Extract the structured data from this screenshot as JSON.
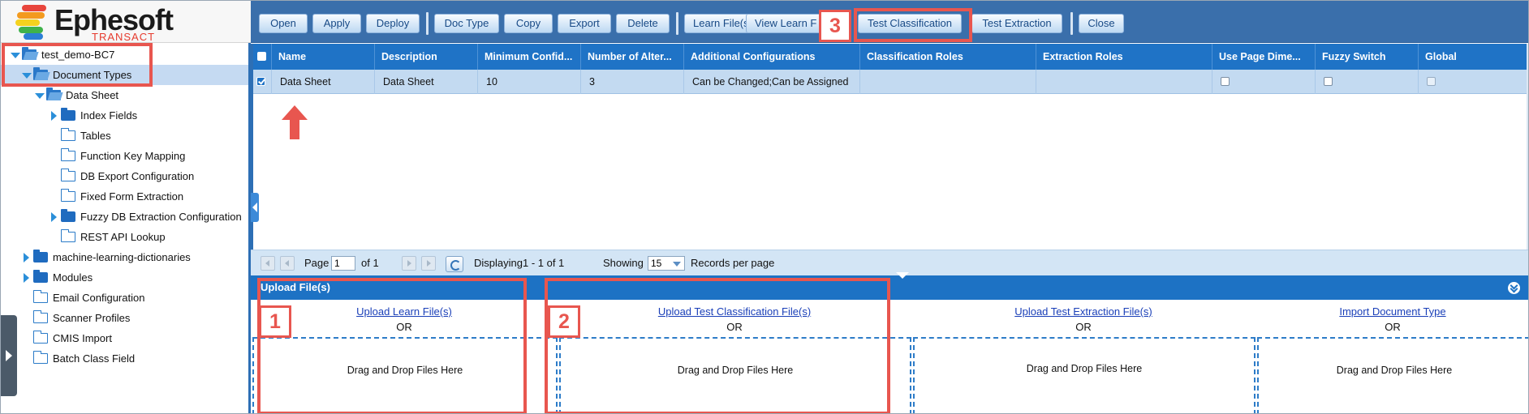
{
  "logo": {
    "brand": "Ephesoft",
    "edition": "TRANSACT"
  },
  "tree": [
    {
      "label": "test_demo-BC7",
      "level": 0,
      "twisty": "down",
      "folder": "open",
      "selected": false
    },
    {
      "label": "Document Types",
      "level": 1,
      "twisty": "down",
      "folder": "open",
      "selected": true
    },
    {
      "label": "Data Sheet",
      "level": 2,
      "twisty": "down",
      "folder": "open",
      "selected": false
    },
    {
      "label": "Index Fields",
      "level": 3,
      "twisty": "right",
      "folder": "filled",
      "selected": false
    },
    {
      "label": "Tables",
      "level": 3,
      "twisty": "none",
      "folder": "outline",
      "selected": false
    },
    {
      "label": "Function Key Mapping",
      "level": 3,
      "twisty": "none",
      "folder": "outline",
      "selected": false
    },
    {
      "label": "DB Export Configuration",
      "level": 3,
      "twisty": "none",
      "folder": "outline",
      "selected": false
    },
    {
      "label": "Fixed Form Extraction",
      "level": 3,
      "twisty": "none",
      "folder": "outline",
      "selected": false
    },
    {
      "label": "Fuzzy DB Extraction Configuration",
      "level": 3,
      "twisty": "right",
      "folder": "filled",
      "selected": false
    },
    {
      "label": "REST API Lookup",
      "level": 3,
      "twisty": "none",
      "folder": "outline",
      "selected": false
    },
    {
      "label": "machine-learning-dictionaries",
      "level": 1,
      "twisty": "right",
      "folder": "filled",
      "selected": false
    },
    {
      "label": "Modules",
      "level": 1,
      "twisty": "right",
      "folder": "filled",
      "selected": false
    },
    {
      "label": "Email Configuration",
      "level": 1,
      "twisty": "none",
      "folder": "outline",
      "selected": false
    },
    {
      "label": "Scanner Profiles",
      "level": 1,
      "twisty": "none",
      "folder": "outline",
      "selected": false
    },
    {
      "label": "CMIS Import",
      "level": 1,
      "twisty": "none",
      "folder": "outline",
      "selected": false
    },
    {
      "label": "Batch Class Field",
      "level": 1,
      "twisty": "none",
      "folder": "outline",
      "selected": false
    }
  ],
  "toolbar": {
    "buttons": [
      "Open",
      "Apply",
      "Deploy",
      "Doc Type",
      "Copy",
      "Export",
      "Delete",
      "Learn File(s)",
      "View Learn F",
      "Test Classification",
      "Test Extraction",
      "Close"
    ]
  },
  "grid": {
    "columns": [
      "Name",
      "Description",
      "Minimum Confid...",
      "Number of Alter...",
      "Additional Configurations",
      "Classification Roles",
      "Extraction Roles",
      "Use Page Dime...",
      "Fuzzy Switch",
      "Global"
    ],
    "rows": [
      {
        "checked": true,
        "cells": [
          "Data Sheet",
          "Data Sheet",
          "10",
          "3",
          "Can be Changed;Can be Assigned",
          "",
          "",
          "",
          "",
          ""
        ]
      }
    ]
  },
  "pager": {
    "page_label": "Page",
    "page_value": "1",
    "of_label": "of 1",
    "displaying": "Displaying1 - 1 of 1",
    "showing_label": "Showing",
    "page_size": "15",
    "records_label": "Records per page"
  },
  "upload": {
    "title": "Upload File(s)",
    "or_text": "OR",
    "drop_text": "Drag and Drop Files Here",
    "links": [
      "Upload Learn File(s)",
      "Upload Test Classification File(s)",
      "Upload Test Extraction File(s)",
      "Import Document Type"
    ]
  },
  "annotations": {
    "badges": [
      "1",
      "2",
      "3"
    ],
    "color": "#e8564f"
  },
  "colors": {
    "header_blue": "#1f73c6",
    "toolbar_blue": "#3a6fab",
    "selection": "#c3daf1"
  }
}
